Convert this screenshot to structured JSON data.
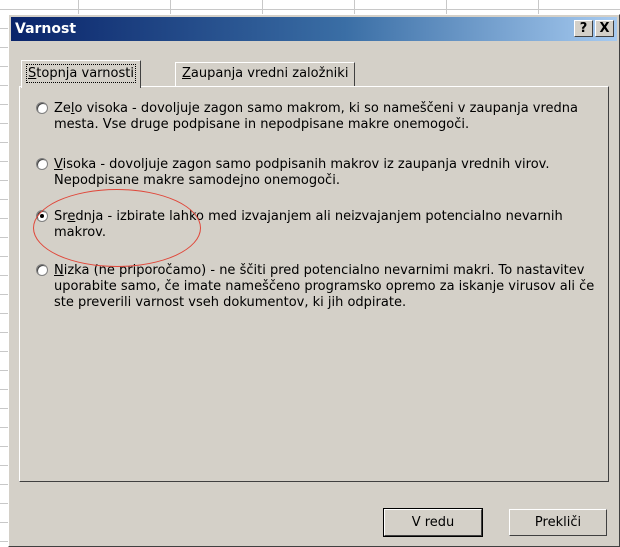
{
  "window": {
    "title": "Varnost",
    "help_glyph": "?",
    "close_glyph": "X"
  },
  "tabs": [
    {
      "label_pre": "",
      "label_key": "S",
      "label_rest": "topnja varnosti"
    },
    {
      "label_pre": "",
      "label_key": "Z",
      "label_rest": "aupanja vredni založniki"
    }
  ],
  "options": [
    {
      "pre": "Ze",
      "key": "l",
      "rest": "o visoka - dovoljuje zagon samo makrom, ki so nameščeni v zaupanja vredna mesta. Vse druge podpisane in nepodpisane makre onemogoči.",
      "checked": false
    },
    {
      "pre": "",
      "key": "V",
      "rest": "isoka - dovoljuje zagon samo podpisanih makrov iz zaupanja vrednih virov. Nepodpisane makre samodejno onemogoči.",
      "checked": false
    },
    {
      "pre": "Sr",
      "key": "e",
      "rest": "dnja - izbirate lahko med izvajanjem ali neizvajanjem potencialno nevarnih makrov.",
      "checked": true
    },
    {
      "pre": "",
      "key": "N",
      "rest": "izka (ne priporočamo) - ne ščiti pred potencialno nevarnimi makri. To nastavitev uporabite samo, če imate nameščeno programsko opremo za iskanje virusov ali če ste preverili varnost vseh dokumentov, ki jih odpirate.",
      "checked": false
    }
  ],
  "buttons": {
    "ok": "V redu",
    "cancel": "Prekliči"
  }
}
